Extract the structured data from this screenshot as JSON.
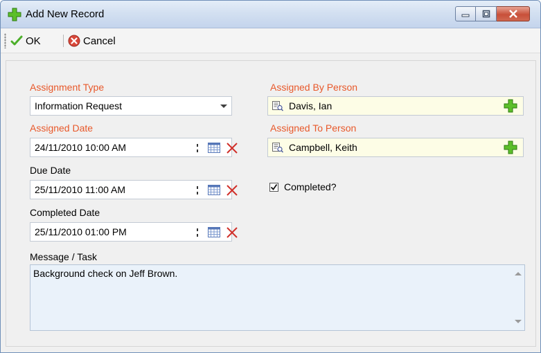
{
  "window": {
    "title": "Add New Record",
    "title_icon": "green-plus-icon",
    "controls": [
      "minimize-icon",
      "maximize-icon",
      "close-icon"
    ]
  },
  "toolbar": {
    "ok_label": "OK",
    "ok_icon": "checkmark-icon",
    "cancel_label": "Cancel",
    "cancel_icon": "cancel-icon"
  },
  "form": {
    "assignment_type": {
      "label": "Assignment Type",
      "value": "Information Request"
    },
    "assigned_date": {
      "label": "Assigned Date",
      "value": "24/11/2010 10:00 AM"
    },
    "due_date": {
      "label": "Due Date",
      "value": "25/11/2010 11:00 AM"
    },
    "completed_date": {
      "label": "Completed Date",
      "value": "25/11/2010 01:00 PM"
    },
    "assigned_by": {
      "label": "Assigned By Person",
      "value": "Davis, Ian"
    },
    "assigned_to": {
      "label": "Assigned To Person",
      "value": "Campbell, Keith"
    },
    "completed": {
      "label": "Completed?",
      "checked": true
    },
    "message": {
      "label": "Message / Task",
      "value": "Background check on Jeff Brown."
    }
  },
  "colors": {
    "required_label": "#e8582a",
    "lookup_field_bg": "#fdfde6",
    "accent_green": "#4caf2a",
    "clear_red": "#d0302a"
  }
}
